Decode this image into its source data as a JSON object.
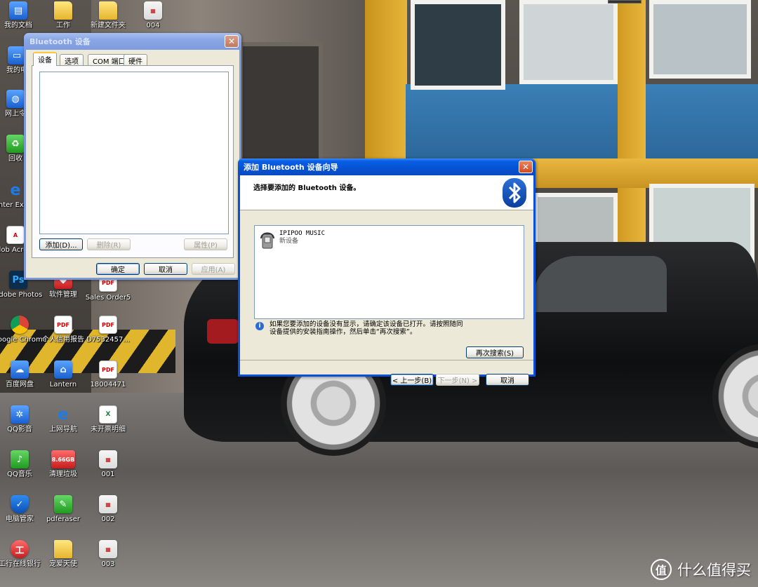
{
  "desktop": {
    "icons": [
      {
        "label": "我的文档",
        "icon": "folder-icon",
        "x": 0,
        "y": 0
      },
      {
        "label": "工作",
        "icon": "folder-icon"
      },
      {
        "label": "新建文件夹",
        "icon": "folder-icon"
      },
      {
        "label": "004",
        "icon": "document-icon"
      },
      {
        "label": "我的电",
        "icon": "computer-icon"
      },
      {
        "label": "网上令",
        "icon": "network-icon"
      },
      {
        "label": "回收",
        "icon": "recycle-bin-icon"
      },
      {
        "label": "Inter Explo",
        "icon": "ie-icon"
      },
      {
        "label": "Adob Acrobat",
        "icon": "acrobat-icon"
      },
      {
        "label": "Adobe Photos",
        "icon": "photoshop-icon"
      },
      {
        "label": "软件管理",
        "icon": "software-manager-icon"
      },
      {
        "label": "Sales Order5",
        "icon": "pdf-icon"
      },
      {
        "label": "Google Chrome",
        "icon": "chrome-icon"
      },
      {
        "label": "个人信用报告",
        "icon": "pdf-icon"
      },
      {
        "label": "D7532457...",
        "icon": "pdf-icon"
      },
      {
        "label": "百度网盘",
        "icon": "baidu-netdisk-icon"
      },
      {
        "label": "Lantern",
        "icon": "lantern-icon"
      },
      {
        "label": "18004471",
        "icon": "pdf-icon"
      },
      {
        "label": "QQ影音",
        "icon": "qq-player-icon"
      },
      {
        "label": "上网导航",
        "icon": "ie-icon"
      },
      {
        "label": "未开票明细",
        "icon": "excel-icon"
      },
      {
        "label": "QQ音乐",
        "icon": "qq-music-icon"
      },
      {
        "label": "清理垃圾",
        "icon": "cleanup-icon",
        "badge": "8.66GB"
      },
      {
        "label": "001",
        "icon": "document-icon"
      },
      {
        "label": "电脑管家",
        "icon": "pc-manager-icon"
      },
      {
        "label": "pdferaser",
        "icon": "pdferaser-icon"
      },
      {
        "label": "002",
        "icon": "document-icon"
      },
      {
        "label": "工行在线银行",
        "icon": "icbc-icon"
      },
      {
        "label": "宠爱天使",
        "icon": "folder-icon"
      },
      {
        "label": "003",
        "icon": "document-icon"
      }
    ]
  },
  "bt_devices_window": {
    "title": "Bluetooth 设备",
    "tabs": [
      "设备",
      "选项",
      "COM 端口",
      "硬件"
    ],
    "active_tab": 0,
    "buttons": {
      "add": "添加(D)...",
      "remove": "删除(R)",
      "properties": "属性(P)",
      "ok": "确定",
      "cancel": "取消",
      "apply": "应用(A)"
    }
  },
  "wizard_window": {
    "title": "添加 Bluetooth 设备向导",
    "heading": "选择要添加的 Bluetooth 设备。",
    "devices": [
      {
        "name": "IPIPOO MUSIC",
        "status": "新设备",
        "icon": "headset-device-icon"
      }
    ],
    "info_text": "如果您要添加的设备没有显示，请确定该设备已打开。请按照随同设备提供的安装指南操作，然后单击“再次搜索”。",
    "buttons": {
      "search_again": "再次搜索(S)",
      "back": "< 上一步(B)",
      "next": "下一步(N) >",
      "cancel": "取消"
    }
  },
  "watermark": {
    "text": "什么值得买",
    "icon": "zhide-logo-icon"
  }
}
